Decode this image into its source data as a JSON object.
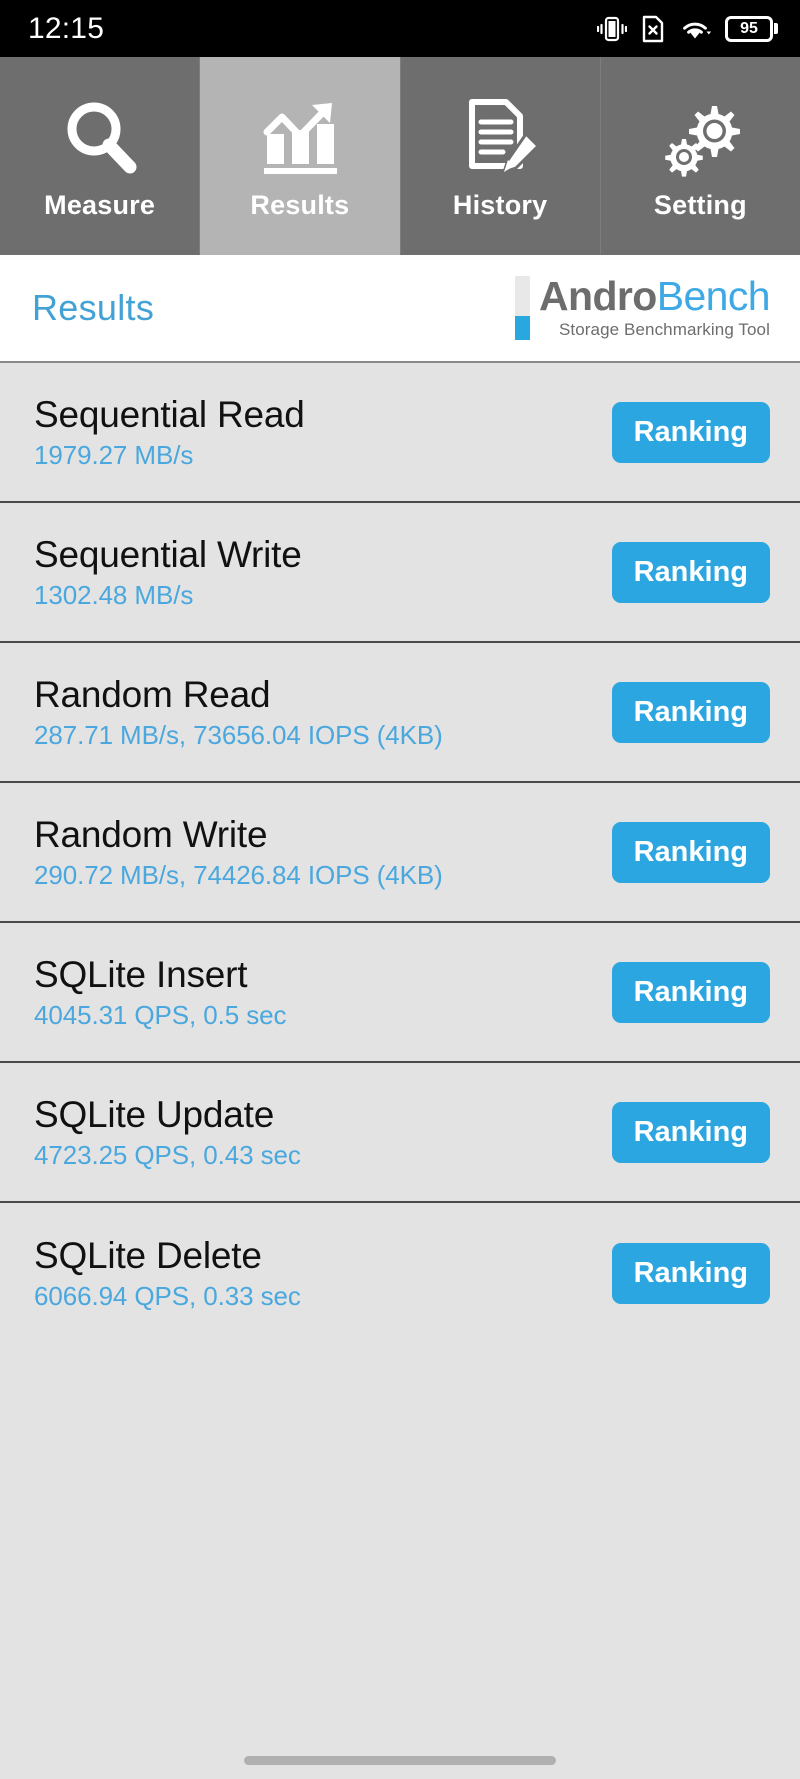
{
  "status_bar": {
    "time": "12:15",
    "battery_percent": "95",
    "icons": [
      "vibrate-icon",
      "no-sim-icon",
      "wifi-icon",
      "battery-icon"
    ]
  },
  "tabs": [
    {
      "label": "Measure",
      "icon": "magnifier-icon",
      "active": false
    },
    {
      "label": "Results",
      "icon": "bar-chart-arrow-icon",
      "active": true
    },
    {
      "label": "History",
      "icon": "document-pencil-icon",
      "active": false
    },
    {
      "label": "Setting",
      "icon": "gears-icon",
      "active": false
    }
  ],
  "header": {
    "page_title": "Results",
    "logo_name_primary": "Andro",
    "logo_name_secondary": "Bench",
    "logo_subtitle": "Storage Benchmarking Tool"
  },
  "results": {
    "ranking_label": "Ranking",
    "rows": [
      {
        "title": "Sequential Read",
        "value": "1979.27 MB/s"
      },
      {
        "title": "Sequential Write",
        "value": "1302.48 MB/s"
      },
      {
        "title": "Random Read",
        "value": "287.71 MB/s, 73656.04 IOPS (4KB)"
      },
      {
        "title": "Random Write",
        "value": "290.72 MB/s, 74426.84 IOPS (4KB)"
      },
      {
        "title": "SQLite Insert",
        "value": "4045.31 QPS, 0.5 sec"
      },
      {
        "title": "SQLite Update",
        "value": "4723.25 QPS, 0.43 sec"
      },
      {
        "title": "SQLite Delete",
        "value": "6066.94 QPS, 0.33 sec"
      }
    ]
  },
  "colors": {
    "accent_blue": "#2ba6e0",
    "value_blue": "#4aa8de",
    "title_blue": "#43a2d4",
    "tab_inactive": "#6e6e6e",
    "tab_active": "#b4b4b4",
    "list_bg": "#e3e3e3"
  }
}
